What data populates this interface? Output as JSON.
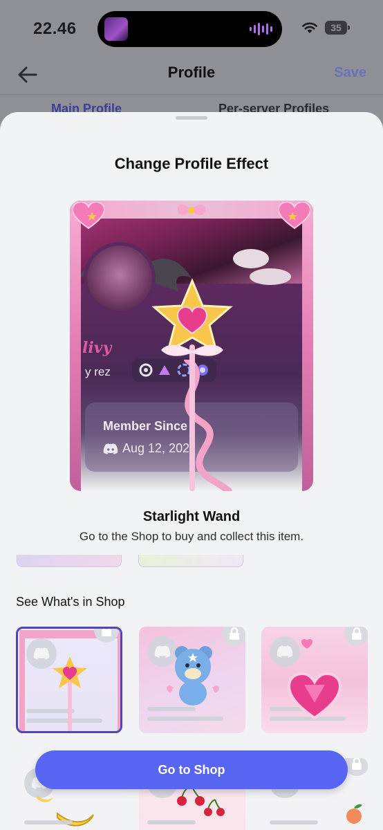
{
  "status_bar": {
    "time": "22.46",
    "battery": "35"
  },
  "header": {
    "title": "Profile",
    "save_label": "Save"
  },
  "tabs": [
    {
      "label": "Main Profile"
    },
    {
      "label": "Per-server Profiles"
    }
  ],
  "sheet": {
    "title": "Change Profile Effect",
    "preview": {
      "display_name": "livy",
      "username": "y   rez",
      "member_since_label": "Member Since",
      "member_since_date": "Aug 12, 202"
    },
    "item_name": "Starlight Wand",
    "item_description": "Go to the Shop to buy and collect this item.",
    "section_label": "See What's in Shop",
    "grid_items": [
      {
        "name": "starlight-wand",
        "locked": true,
        "selected": true
      },
      {
        "name": "blue-bear",
        "locked": true,
        "selected": false
      },
      {
        "name": "pink-heart-gem",
        "locked": true,
        "selected": false
      },
      {
        "name": "banana",
        "locked": false,
        "selected": false
      },
      {
        "name": "cherries",
        "locked": false,
        "selected": false
      },
      {
        "name": "peach",
        "locked": true,
        "selected": false
      }
    ],
    "go_to_shop_label": "Go to Shop"
  },
  "colors": {
    "accent": "#5865f2",
    "selected_border": "#4f46b9",
    "save": "#5865c8"
  }
}
